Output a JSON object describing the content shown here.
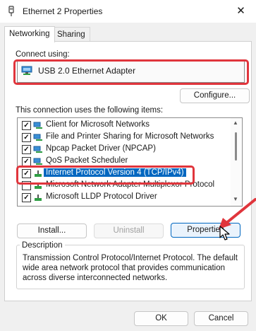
{
  "window": {
    "title": "Ethernet 2 Properties",
    "close_glyph": "✕"
  },
  "tabs": [
    {
      "label": "Networking",
      "active": true
    },
    {
      "label": "Sharing",
      "active": false
    }
  ],
  "connect_using": {
    "label": "Connect using:",
    "adapter": "USB 2.0 Ethernet Adapter",
    "adapter_icon": "network-adapter-icon",
    "configure_button": "Configure..."
  },
  "items_label": "This connection uses the following items:",
  "items": [
    {
      "label": "Client for Microsoft Networks",
      "checked": true,
      "icon": "network-client-icon"
    },
    {
      "label": "File and Printer Sharing for Microsoft Networks",
      "checked": true,
      "icon": "network-service-icon"
    },
    {
      "label": "Npcap Packet Driver (NPCAP)",
      "checked": true,
      "icon": "protocol-icon"
    },
    {
      "label": "QoS Packet Scheduler",
      "checked": true,
      "icon": "network-service-icon"
    },
    {
      "label": "Internet Protocol Version 4 (TCP/IPv4)",
      "checked": true,
      "selected": true,
      "icon": "protocol-icon"
    },
    {
      "label": "Microsoft Network Adapter Multiplexor Protocol",
      "checked": false,
      "icon": "protocol-icon"
    },
    {
      "label": "Microsoft LLDP Protocol Driver",
      "checked": true,
      "icon": "protocol-icon"
    }
  ],
  "buttons": {
    "install": "Install...",
    "uninstall": "Uninstall",
    "properties": "Properties"
  },
  "description": {
    "title": "Description",
    "text": "Transmission Control Protocol/Internet Protocol. The default wide area network protocol that provides communication across diverse interconnected networks."
  },
  "footer": {
    "ok": "OK",
    "cancel": "Cancel"
  },
  "colors": {
    "highlight": "#e0353c",
    "selection": "#0067c0",
    "accent": "#0067c0"
  }
}
